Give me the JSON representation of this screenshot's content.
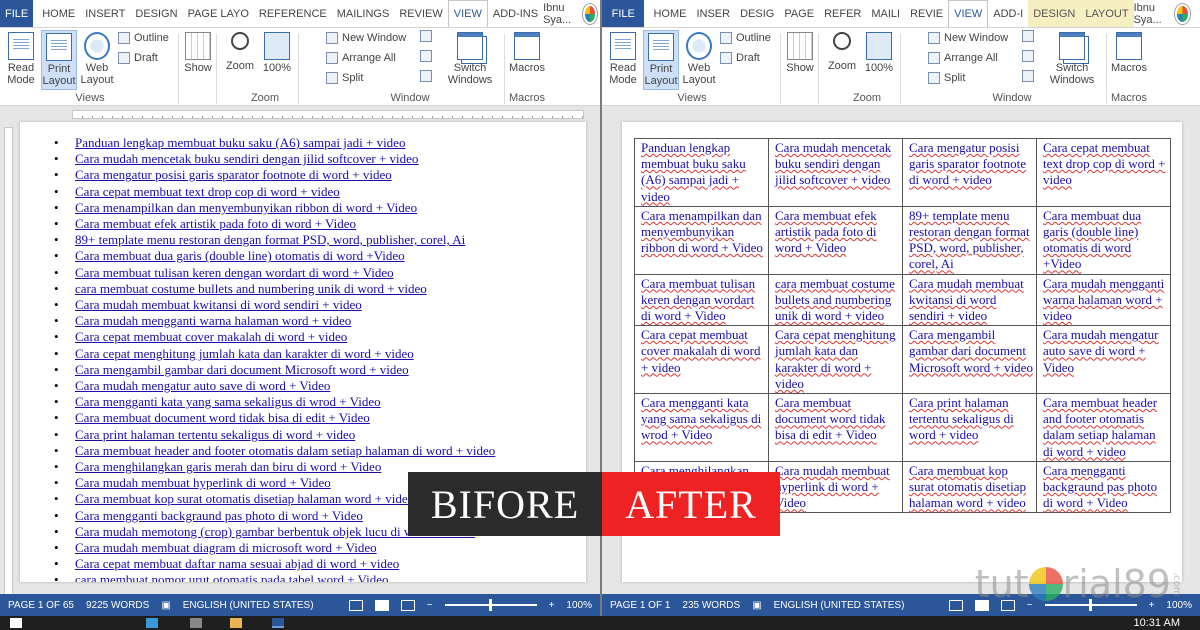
{
  "left": {
    "tabs": [
      "FILE",
      "HOME",
      "INSERT",
      "DESIGN",
      "PAGE LAYO",
      "REFERENCE",
      "MAILINGS",
      "REVIEW",
      "VIEW",
      "ADD-INS"
    ],
    "active_tab": "VIEW",
    "user": "Ibnu Sya...",
    "ribbon": {
      "read_mode": "Read Mode",
      "print_layout": "Print Layout",
      "web_layout": "Web Layout",
      "outline": "Outline",
      "draft": "Draft",
      "views_group": "Views",
      "show": "Show",
      "zoom": "Zoom",
      "zoom100": "100%",
      "zoom_group": "Zoom",
      "new_window": "New Window",
      "arrange_all": "Arrange All",
      "split": "Split",
      "switch_windows": "Switch Windows",
      "window_group": "Window",
      "macros": "Macros",
      "macros_group": "Macros"
    },
    "list": [
      "Panduan lengkap membuat buku saku (A6) sampai jadi + video",
      "Cara mudah mencetak buku sendiri dengan jilid softcover + video",
      "Cara mengatur posisi garis sparator footnote di word + video",
      "Cara cepat membuat text drop cop di word + video",
      "Cara menampilkan dan menyembunyikan ribbon di word + Video",
      "Cara membuat efek artistik pada foto di word + Video",
      "89+ template menu restoran dengan format PSD, word, publisher, corel, Ai",
      "Cara membuat dua garis (double line) otomatis di word +Video",
      "Cara membuat tulisan keren dengan wordart di word + Video",
      "cara membuat costume bullets and numbering unik di word + video",
      "Cara mudah membuat kwitansi di word sendiri + video",
      "Cara mudah mengganti warna halaman word + video",
      "Cara cepat membuat cover makalah di word + video",
      "Cara cepat menghitung jumlah kata dan karakter di word + video",
      "Cara mengambil gambar dari document Microsoft word + video",
      "Cara mudah mengatur auto save di word + Video",
      "Cara mengganti kata yang sama sekaligus di wrod + Video",
      "Cara membuat document word tidak bisa di edit + Video",
      "Cara print halaman tertentu sekaligus di word + video",
      "Cara membuat header and footer otomatis dalam setiap halaman di word + video",
      "Cara menghilangkan garis merah dan biru di word + Video",
      "Cara mudah membuat hyperlink di word + Video",
      "Cara membuat kop surat otomatis disetiap halaman word + video",
      "Cara mengganti backgraund pas photo di word + Video",
      "Cara mudah memotong (crop) gambar berbentuk objek lucu di word + Video",
      "Cara mudah membuat diagram di microsoft word + Video",
      "Cara cepat membuat daftar nama sesuai abjad di word + video",
      "cara membuat nomor urut otomatis pada tabel word + Video"
    ],
    "status": {
      "page": "PAGE 1 OF 65",
      "words": "9225 WORDS",
      "language": "ENGLISH (UNITED STATES)",
      "zoom": "100%"
    }
  },
  "right": {
    "tabs": [
      "FILE",
      "HOME",
      "INSER",
      "DESIG",
      "PAGE",
      "REFER",
      "MAILI",
      "REVIE",
      "VIEW",
      "ADD-I",
      "DESIGN",
      "LAYOUT"
    ],
    "active_tab": "VIEW",
    "user": "Ibnu Sya...",
    "table": [
      [
        "Panduan lengkap membuat buku saku (A6) sampai jadi + video",
        "Cara mudah mencetak buku sendiri dengan jilid softcover + video",
        "Cara mengatur posisi garis sparator footnote di word + video",
        "Cara cepat membuat text drop cop di word + video"
      ],
      [
        "Cara menampilkan dan menyembunyikan ribbon di word + Video",
        "Cara membuat efek artistik pada foto di word + Video",
        "89+ template menu restoran dengan format PSD, word, publisher, corel, Ai",
        "Cara membuat dua garis (double line) otomatis di word +Video"
      ],
      [
        "Cara membuat tulisan keren dengan wordart di word + Video",
        "cara membuat costume bullets and numbering unik di word + video",
        "Cara mudah membuat kwitansi di word sendiri + video",
        "Cara mudah mengganti warna halaman word + video"
      ],
      [
        "Cara cepat membuat cover makalah di word + video",
        "Cara cepat menghitung jumlah kata dan karakter di word + video",
        "Cara mengambil gambar dari document Microsoft word + video",
        "Cara mudah mengatur auto save di word + Video"
      ],
      [
        "Cara mengganti kata yang sama sekaligus di wrod + Video",
        "Cara membuat document word tidak bisa di edit + Video",
        "Cara print halaman tertentu sekaligus di word + video",
        "Cara membuat header and footer otomatis dalam setiap halaman di word + video"
      ],
      [
        "Cara menghilangkan garis merah dan biru di word + Video",
        "Cara mudah membuat hyperlink di word + Video",
        "Cara membuat kop surat otomatis disetiap halaman word + video",
        "Cara mengganti backgraund pas photo di word + Video"
      ]
    ],
    "status": {
      "page": "PAGE 1 OF 1",
      "words": "235 WORDS",
      "language": "ENGLISH (UNITED STATES)",
      "zoom": "100%"
    }
  },
  "overlay": {
    "before": "BIFORE",
    "after": "AFTER"
  },
  "watermark": {
    "prefix": "tut",
    "suffix": "rial89",
    "domain": ".com"
  },
  "clock": "10:31 AM",
  "colors": {
    "word_blue": "#2b579a",
    "link": "#1a0dab",
    "after_red": "#ee2222",
    "before_dark": "#2b2b2b"
  }
}
